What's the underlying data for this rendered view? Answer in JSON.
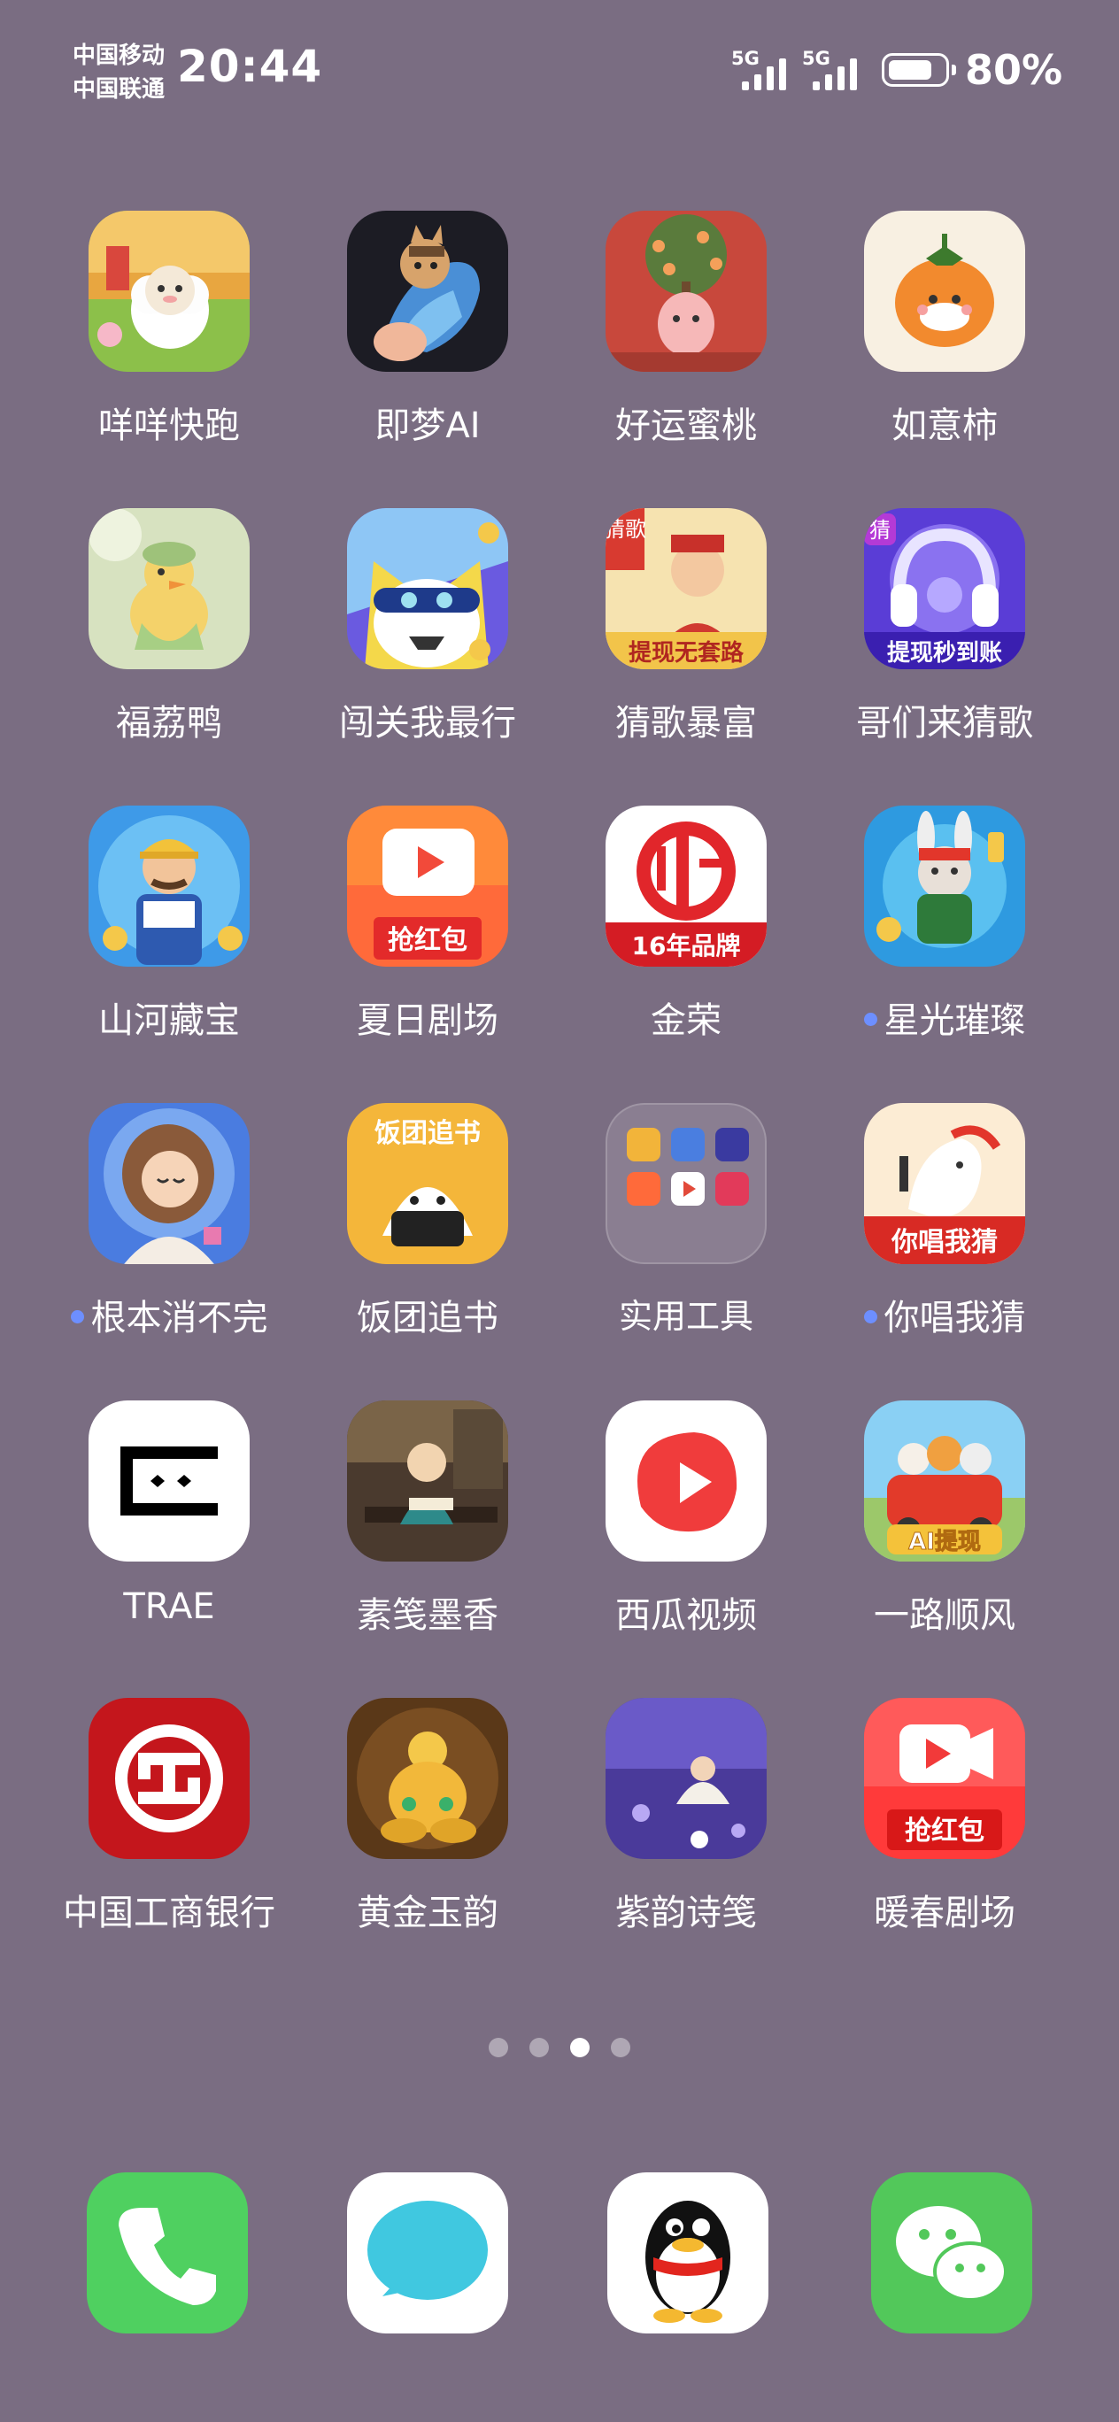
{
  "status_bar": {
    "carrier_1": "中国移动",
    "carrier_2": "中国联通",
    "time": "20:44",
    "signal_1_label": "5G",
    "signal_2_label": "5G",
    "battery_level": 0.8,
    "battery_text": "80%"
  },
  "apps": [
    {
      "label": "咩咩快跑",
      "icon": "sheep-icon",
      "notify": false
    },
    {
      "label": "即梦AI",
      "icon": "jimeng-horse-icon",
      "notify": false
    },
    {
      "label": "好运蜜桃",
      "icon": "peach-tree-icon",
      "notify": false
    },
    {
      "label": "如意柿",
      "icon": "persimmon-icon",
      "notify": false
    },
    {
      "label": "福荔鸭",
      "icon": "duck-icon",
      "notify": false
    },
    {
      "label": "闯关我最行",
      "icon": "cat-game-icon",
      "notify": false
    },
    {
      "label": "猜歌暴富",
      "icon": "god-of-wealth-icon",
      "notify": false
    },
    {
      "label": "哥们来猜歌",
      "icon": "headphones-icon",
      "notify": false
    },
    {
      "label": "山河藏宝",
      "icon": "treasure-hunter-icon",
      "notify": false
    },
    {
      "label": "夏日剧场",
      "icon": "summer-theater-icon",
      "notify": false
    },
    {
      "label": "金荣",
      "icon": "jinrong-icon",
      "notify": false
    },
    {
      "label": "星光璀璨",
      "icon": "rabbit-star-icon",
      "notify": true
    },
    {
      "label": "根本消不完",
      "icon": "girl-game-icon",
      "notify": true
    },
    {
      "label": "饭团追书",
      "icon": "rice-ball-icon",
      "notify": false
    },
    {
      "label": "实用工具",
      "icon": "folder-icon",
      "notify": false
    },
    {
      "label": "你唱我猜",
      "icon": "singing-horse-icon",
      "notify": true
    },
    {
      "label": "TRAE",
      "icon": "trae-icon",
      "notify": false
    },
    {
      "label": "素笺墨香",
      "icon": "scholar-icon",
      "notify": false
    },
    {
      "label": "西瓜视频",
      "icon": "xigua-video-icon",
      "notify": false
    },
    {
      "label": "一路顺风",
      "icon": "car-animals-icon",
      "notify": false
    },
    {
      "label": "中国工商银行",
      "icon": "icbc-icon",
      "notify": false
    },
    {
      "label": "黄金玉韵",
      "icon": "gold-gourd-icon",
      "notify": false
    },
    {
      "label": "紫韵诗笺",
      "icon": "purple-poem-icon",
      "notify": false
    },
    {
      "label": "暖春剧场",
      "icon": "spring-theater-icon",
      "notify": false
    }
  ],
  "icon_texts": {
    "summer_theater_banner": "抢红包",
    "jinrong_banner": "16年品牌",
    "rice_ball_banner": "饭团追书",
    "singing_banner": "你唱我猜",
    "god_wealth_banner": "提现无套路",
    "god_wealth_corner": "猜歌",
    "headphones_banner": "提现秒到账",
    "headphones_corner": "猜",
    "car_banner": "AI提现",
    "spring_banner": "抢红包",
    "jimeng_ai": "AI"
  },
  "pager": {
    "count": 4,
    "active": 2
  },
  "dock": [
    {
      "name": "phone",
      "icon": "phone-icon"
    },
    {
      "name": "messages",
      "icon": "message-bubble-icon"
    },
    {
      "name": "qq",
      "icon": "qq-penguin-icon"
    },
    {
      "name": "wechat",
      "icon": "wechat-icon"
    }
  ]
}
